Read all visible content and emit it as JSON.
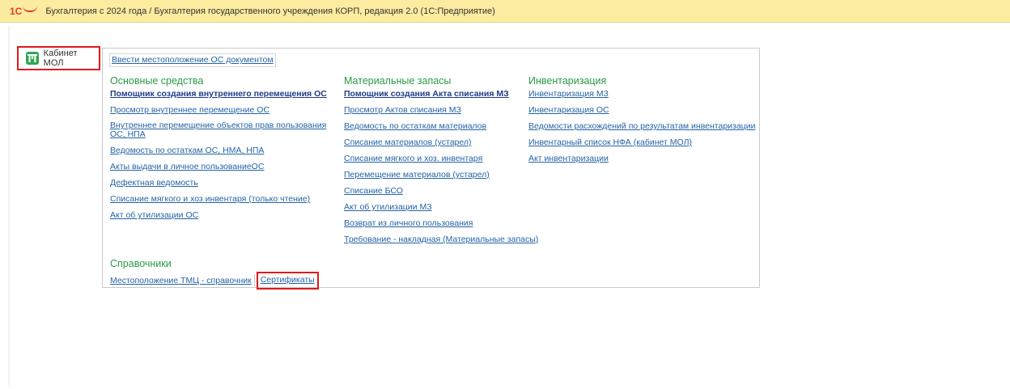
{
  "titlebar": {
    "logo_text": "1С",
    "app_title": "Бухгалтерия с 2024 года / Бухгалтерия государственного учреждения КОРП, редакция 2.0  (1С:Предприятие)"
  },
  "sidebar": {
    "kabinet_icon": "ПП",
    "kabinet_label": "Кабинет МОЛ"
  },
  "panel": {
    "top_link": "Ввести местоположение ОС документом",
    "sections": [
      {
        "title": "Основные средства",
        "links": [
          "Помощник создания внутреннего перемещения ОС",
          "Просмотр внутреннее перемещение ОС",
          "Внутреннее перемещение объектов прав пользования ОС, НПА",
          "Ведомость по остаткам ОС, НМА, НПА",
          "Акты выдачи в личное пользованиеОС",
          "Дефектная ведомость",
          "Списание мягкого и хоз инвентаря (только чтение)",
          "Акт об утилизации ОС"
        ]
      },
      {
        "title": "Материальные запасы",
        "links": [
          "Помощник создания Акта списания МЗ",
          "Просмотр Актов списания МЗ",
          "Ведомость по остаткам материалов",
          "Списание материалов (устарел)",
          "Списание мягкого и хоз. инвентаря",
          "Перемещение материалов (устарел)",
          "Списание БСО",
          "Акт об утилизации МЗ",
          "Возврат из личного пользования",
          "Требование - накладная (Материальные запасы)"
        ]
      },
      {
        "title": "Инвентаризация",
        "links": [
          "Инвентаризация МЗ",
          "Инвентаризация ОС",
          "Ведомости расхождений по результатам инвентаризации",
          "Инвентарный список НФА (кабинет МОЛ)",
          "Акт инвентаризации"
        ]
      }
    ],
    "references": {
      "title": "Справочники",
      "links": [
        "Местоположение ТМЦ - справочник",
        "Сертификаты"
      ]
    }
  },
  "colors": {
    "titlebar_bg": "#fbeca0",
    "section_title": "#2b9a47",
    "link": "#2563a5",
    "highlight_border": "#e01b1b",
    "icon_green": "#2fa651"
  }
}
